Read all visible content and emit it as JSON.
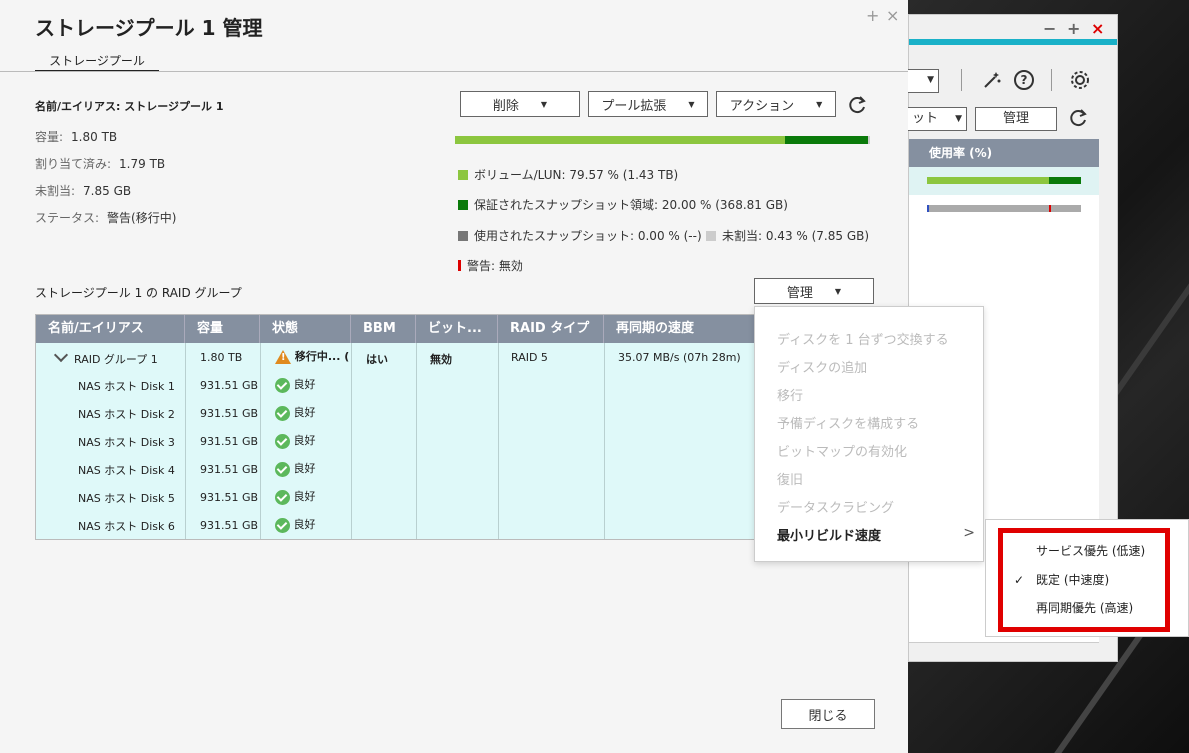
{
  "dialog": {
    "title": "ストレージプール 1 管理",
    "ctrl_plus": "+",
    "ctrl_close": "×",
    "tab": "ストレージプール"
  },
  "info": {
    "name_label": "名前/エイリアス:",
    "name_value": "ストレージプール 1",
    "capacity_label": "容量:",
    "capacity_value": "1.80 TB",
    "allocated_label": "割り当て済み:",
    "allocated_value": "1.79 TB",
    "unallocated_label": "未割当:",
    "unallocated_value": "7.85 GB",
    "status_label": "ステータス:",
    "status_value": "警告(移行中)"
  },
  "toolbar": {
    "delete": "削除",
    "expand": "プール拡張",
    "action": "アクション"
  },
  "usage": {
    "segments": [
      {
        "name": "volume",
        "percent": 79.57,
        "color": "#8cc63f"
      },
      {
        "name": "guaranteed",
        "percent": 20.0,
        "color": "#0a7a0a"
      },
      {
        "name": "used_snapshot",
        "percent": 0.0,
        "color": "#777777"
      },
      {
        "name": "unallocated",
        "percent": 0.43,
        "color": "#cccccc"
      }
    ],
    "legend_volume": "ボリューム/LUN: 79.57 % (1.43 TB)",
    "legend_guaranteed": "保証されたスナップショット領域: 20.00 % (368.81 GB)",
    "legend_used_snapshot": "使用されたスナップショット: 0.00 % (--)",
    "legend_unallocated": "未割当: 0.43 % (7.85 GB)",
    "legend_warning": "警告: 無効"
  },
  "raid_section": {
    "label": "ストレージプール 1 の RAID グループ",
    "manage_button": "管理"
  },
  "table": {
    "headers": [
      "名前/エイリアス",
      "容量",
      "状態",
      "BBM",
      "ビット...",
      "RAID タイプ",
      "再同期の速度"
    ],
    "group": {
      "name": "RAID グループ 1",
      "capacity": "1.80 TB",
      "status": "移行中... (",
      "bbm": "はい",
      "bitmap": "無効",
      "raid_type": "RAID 5",
      "resync": "35.07 MB/s (07h 28m)"
    },
    "disks": [
      {
        "name": "NAS ホスト Disk 1",
        "capacity": "931.51 GB",
        "status": "良好"
      },
      {
        "name": "NAS ホスト Disk 2",
        "capacity": "931.51 GB",
        "status": "良好"
      },
      {
        "name": "NAS ホスト Disk 3",
        "capacity": "931.51 GB",
        "status": "良好"
      },
      {
        "name": "NAS ホスト Disk 4",
        "capacity": "931.51 GB",
        "status": "良好"
      },
      {
        "name": "NAS ホスト Disk 5",
        "capacity": "931.51 GB",
        "status": "良好"
      },
      {
        "name": "NAS ホスト Disk 6",
        "capacity": "931.51 GB",
        "status": "良好"
      }
    ]
  },
  "menu": {
    "items": [
      "ディスクを 1 台ずつ交換する",
      "ディスクの追加",
      "移行",
      "予備ディスクを構成する",
      "ビットマップの有効化",
      "復旧",
      "データスクラビング",
      "最小リビルド速度"
    ]
  },
  "submenu": {
    "items": [
      "サービス優先 (低速)",
      "既定 (中速度)",
      "再同期優先 (高速)"
    ],
    "checked": "✓"
  },
  "close_button": "閉じる",
  "background_window": {
    "manage_button": "管理",
    "select_fragment": "ット",
    "header_usage": "使用率 (%)"
  }
}
